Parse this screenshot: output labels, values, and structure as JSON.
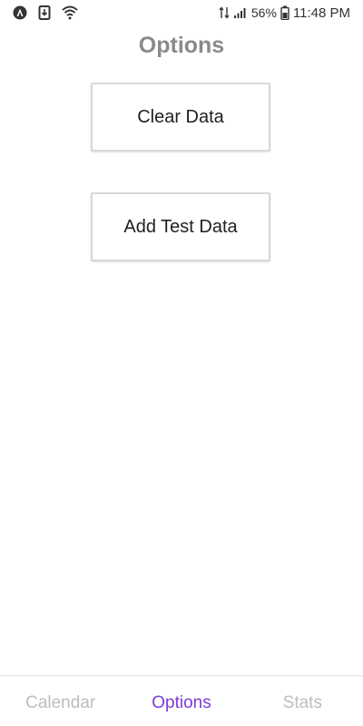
{
  "status_bar": {
    "left_icons": [
      "android-auto-icon",
      "download-icon",
      "wifi-icon"
    ],
    "battery_pct": "56%",
    "time": "11:48 PM"
  },
  "page": {
    "title": "Options"
  },
  "buttons": {
    "clear_data": "Clear Data",
    "add_test_data": "Add Test Data"
  },
  "bottom_nav": {
    "tabs": [
      {
        "label": "Calendar",
        "active": false
      },
      {
        "label": "Options",
        "active": true
      },
      {
        "label": "Stats",
        "active": false
      }
    ]
  },
  "colors": {
    "accent": "#7e3bd6",
    "inactive_tab": "#bdbdbd",
    "title": "#8a8a8a"
  }
}
